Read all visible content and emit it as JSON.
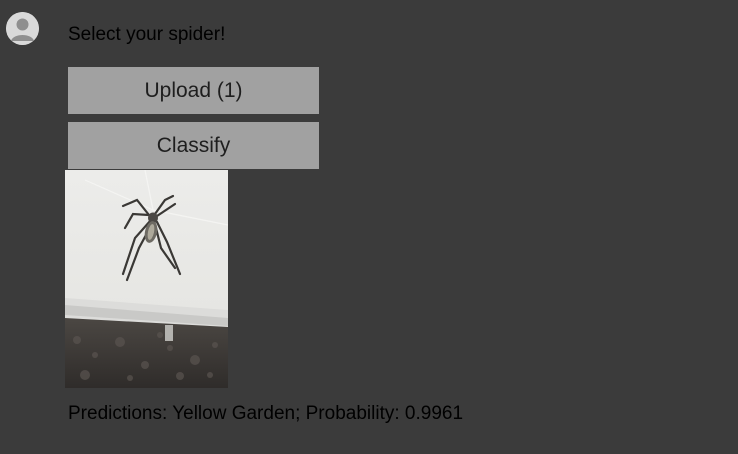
{
  "user": {
    "avatar_icon": "user-avatar-icon"
  },
  "message": {
    "prompt": "Select your spider!"
  },
  "buttons": {
    "upload_label": "Upload (1)",
    "classify_label": "Classify"
  },
  "image": {
    "subject_icon": "spider-photo"
  },
  "result": {
    "text": "Predictions: Yellow Garden; Probability: 0.9961"
  },
  "colors": {
    "background": "#3b3b3b",
    "button": "#a1a1a1",
    "text": "#000000"
  }
}
